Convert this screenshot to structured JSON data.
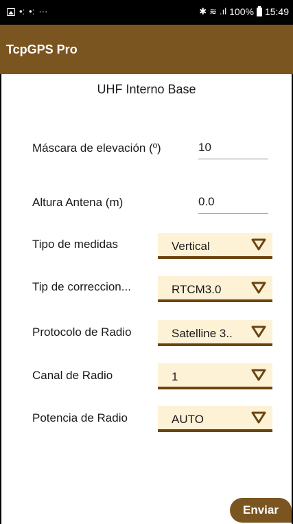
{
  "status_bar": {
    "left_icons": [
      "image-icon",
      "notification-icon",
      "notification-icon",
      "more-icon"
    ],
    "right_icons": [
      "bluetooth-icon",
      "wifi-icon",
      "signal-icon"
    ],
    "battery": "100%",
    "time": "15:49"
  },
  "app_bar": {
    "title": "TcpGPS Pro"
  },
  "page": {
    "subtitle": "UHF Interno Base"
  },
  "fields": {
    "elevation_mask": {
      "label": "Máscara de elevación (º)",
      "value": "10"
    },
    "antenna_height": {
      "label": "Altura Antena (m)",
      "value": "0.0"
    },
    "measure_type": {
      "label": "Tipo de medidas",
      "value": "Vertical"
    },
    "correction_type": {
      "label": "Tip de correccion...",
      "value": "RTCM3.0"
    },
    "radio_protocol": {
      "label": "Protocolo de Radio",
      "value": "Satelline 3.."
    },
    "radio_channel": {
      "label": "Canal de Radio",
      "value": "1"
    },
    "radio_power": {
      "label": "Potencia de Radio",
      "value": "AUTO"
    }
  },
  "actions": {
    "send_label": "Enviar"
  },
  "colors": {
    "primary": "#7b5520",
    "dropdown_bg": "#fdf1d6",
    "underline": "#6b4510"
  }
}
